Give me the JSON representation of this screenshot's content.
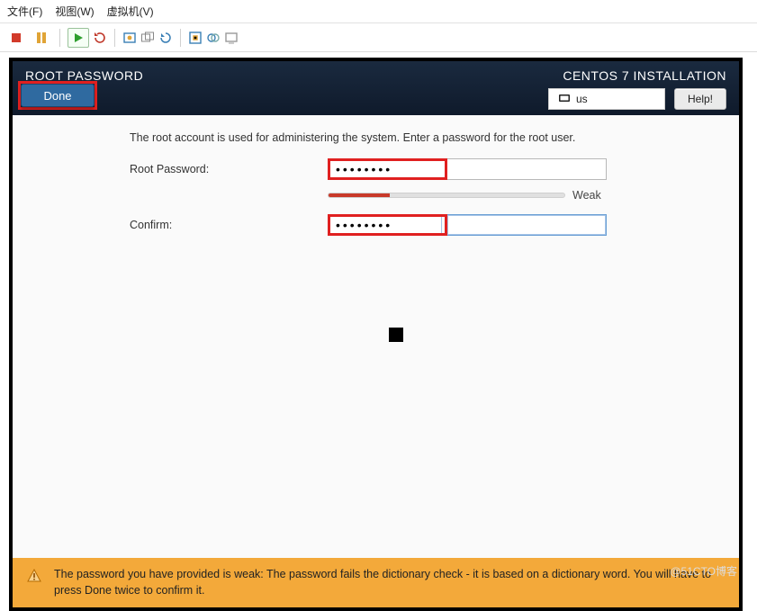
{
  "host_menu": {
    "file": "文件(F)",
    "view": "视图(W)",
    "vm": "虚拟机(V)"
  },
  "header": {
    "title": "ROOT PASSWORD",
    "brand": "CENTOS 7 INSTALLATION",
    "keyboard": "us",
    "help": "Help!",
    "done": "Done"
  },
  "body": {
    "intro": "The root account is used for administering the system.  Enter a password for the root user.",
    "root_label": "Root Password:",
    "confirm_label": "Confirm:",
    "password_value": "••••••••",
    "confirm_value": "••••••••",
    "strength": "Weak"
  },
  "warning": {
    "text": "The password you have provided is weak: The password fails the dictionary check - it is based on a dictionary word. You will have to press Done twice to confirm it."
  },
  "watermark": "@51CTO博客"
}
